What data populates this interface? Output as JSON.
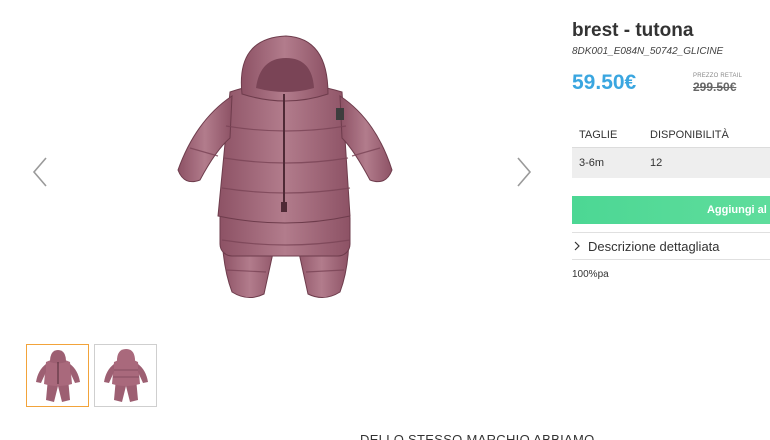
{
  "product": {
    "title": "brest - tutona",
    "sku": "8DK001_E084N_50742_GLICINE",
    "price": "59.50€",
    "retail_label": "PREZZO RETAIL",
    "retail_price": "299.50€"
  },
  "sizes": {
    "header_size": "TAGLIE",
    "header_availability": "DISPONIBILITÀ",
    "rows": [
      {
        "size": "3-6m",
        "availability": "12"
      }
    ]
  },
  "actions": {
    "add_to_cart": "Aggiungi al c"
  },
  "description": {
    "toggle_label": "Descrizione dettagliata",
    "text": "100%pa"
  },
  "gallery": {
    "prev_icon": "chevron-left-icon",
    "next_icon": "chevron-right-icon",
    "thumbnails": [
      "front-view",
      "back-view"
    ],
    "active_thumbnail": "front-view"
  },
  "footer": {
    "heading": "DELLO STESSO MARCHIO ABBIAMO"
  },
  "colors": {
    "price": "#3aa6e0",
    "button": "#52d997",
    "active_thumb_border": "#f2a33a",
    "garment": "#a4687a"
  }
}
